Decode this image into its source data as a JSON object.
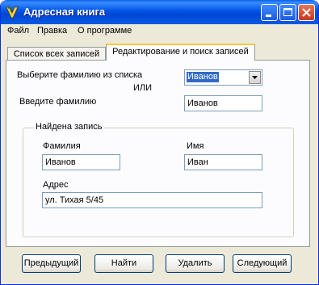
{
  "window": {
    "title": "Адресная книга"
  },
  "menu": [
    "Файл",
    "Правка",
    "О программе"
  ],
  "tabs": [
    "Список всех записей",
    "Редактирование и поиск записей"
  ],
  "search": {
    "select_label": "Выберите фамилию из списка",
    "or_label": "ИЛИ",
    "combo_value": "Иванов",
    "enter_label": "Введите фамилию",
    "enter_value": "Иванов"
  },
  "record": {
    "group_title": "Найдена запись",
    "surname_label": "Фамилия",
    "surname_value": "Иванов",
    "name_label": "Имя",
    "name_value": "Иван",
    "address_label": "Адрес",
    "address_value": "ул. Тихая 5/45"
  },
  "buttons": {
    "prev": "Предыдущий",
    "find": "Найти",
    "delete": "Удалить",
    "next": "Следующий"
  },
  "colors": {
    "titlebar": "#0055E5",
    "face": "#ECE9D8",
    "selection": "#316AC5",
    "tab_highlight": "#FFC73C"
  }
}
